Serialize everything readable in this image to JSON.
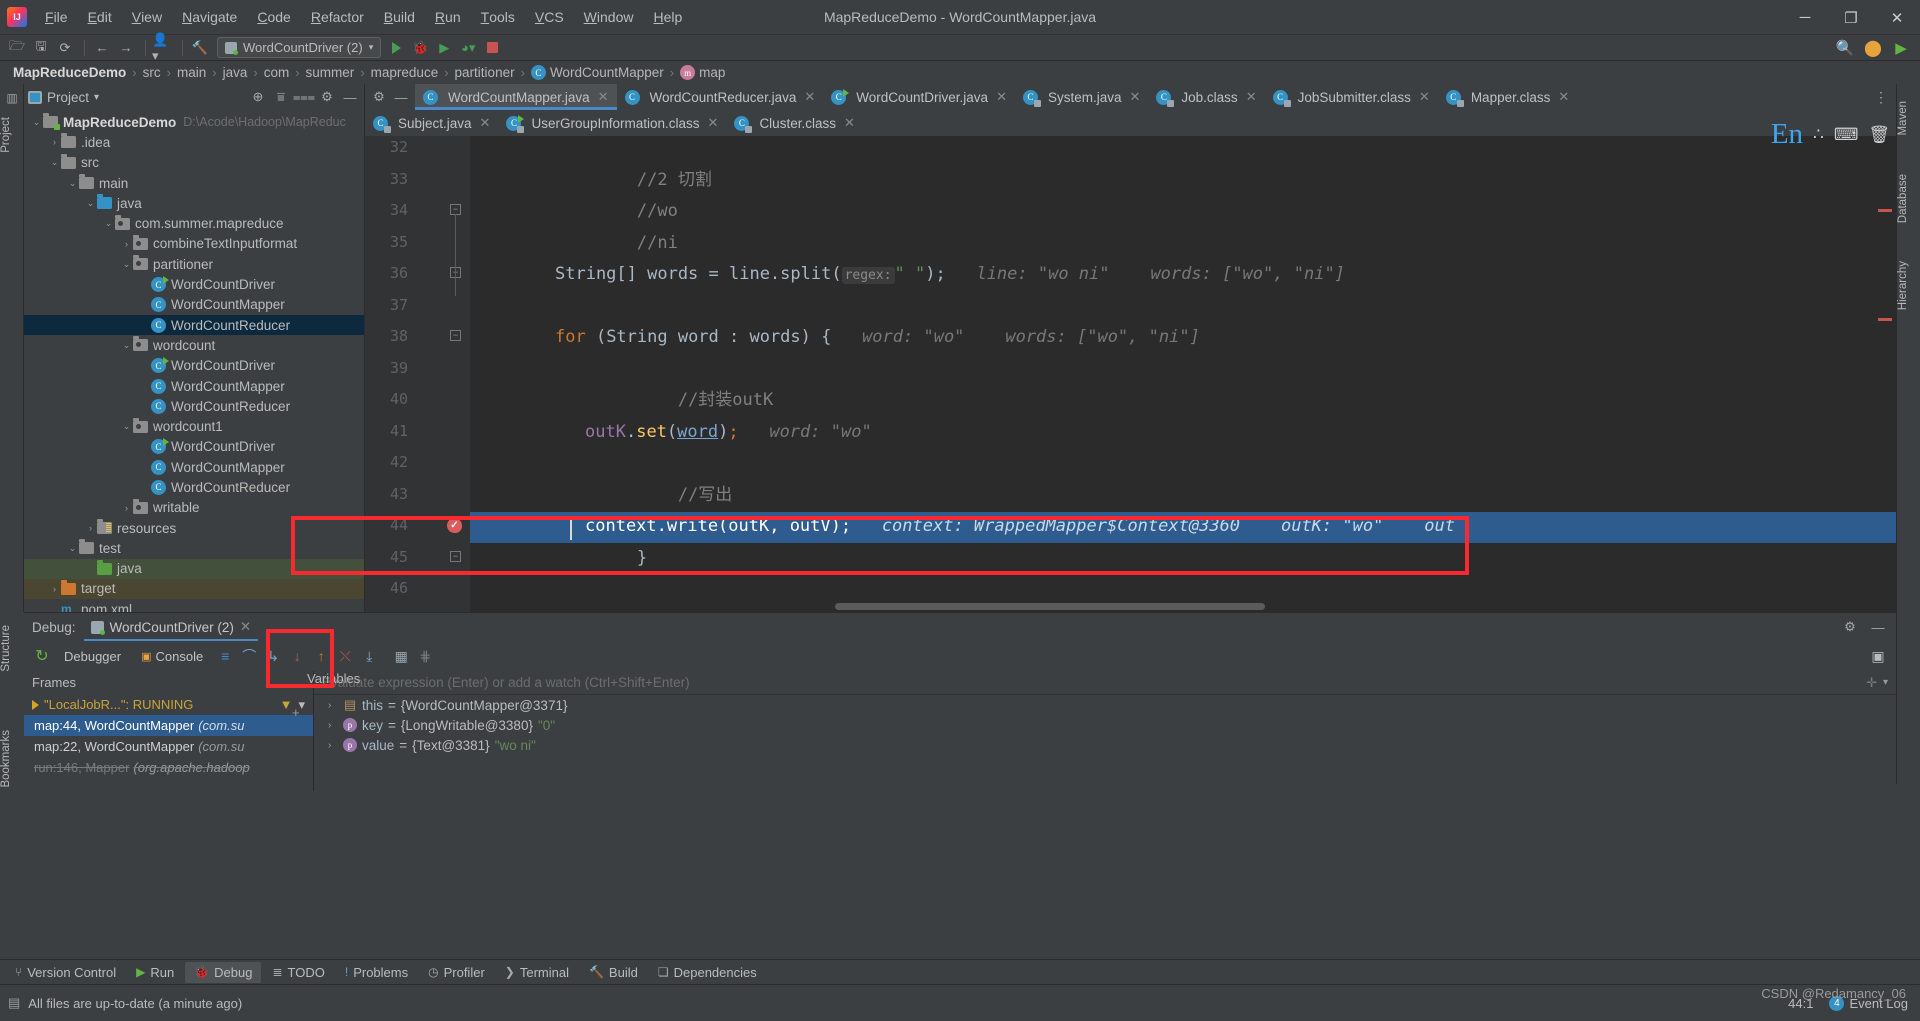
{
  "window": {
    "title": "MapReduceDemo - WordCountMapper.java",
    "minimize": "─",
    "maximize": "❐",
    "close": "✕"
  },
  "menubar": [
    "File",
    "Edit",
    "View",
    "Navigate",
    "Code",
    "Refactor",
    "Build",
    "Run",
    "Tools",
    "VCS",
    "Window",
    "Help"
  ],
  "toolbar": {
    "run_config": "WordCountDriver (2)",
    "icons": [
      "open-folder-icon",
      "save-icon",
      "sync-icon",
      "back-arrow-icon",
      "forward-arrow-icon",
      "profile-icon",
      "build-hammer-icon"
    ],
    "right_icons": [
      "search-icon",
      "update-icon",
      "run-anything-icon"
    ]
  },
  "breadcrumb": {
    "items": [
      "MapReduceDemo",
      "src",
      "main",
      "java",
      "com",
      "summer",
      "mapreduce",
      "partitioner",
      "WordCountMapper",
      "map"
    ],
    "separator": "›"
  },
  "project_panel": {
    "title": "Project",
    "chevron": "▾",
    "actions": [
      "locate-icon",
      "expand-all-icon",
      "collapse-all-icon",
      "gear-icon",
      "hide-icon"
    ],
    "tree": [
      {
        "depth": 0,
        "arrow": "⌄",
        "icon": "module-folder",
        "label": "MapReduceDemo",
        "bold": true,
        "dim": "D:\\Acode\\Hadoop\\MapReduc"
      },
      {
        "depth": 1,
        "arrow": "›",
        "icon": "folder",
        "label": ".idea"
      },
      {
        "depth": 1,
        "arrow": "⌄",
        "icon": "folder",
        "label": "src"
      },
      {
        "depth": 2,
        "arrow": "⌄",
        "icon": "folder",
        "label": "main"
      },
      {
        "depth": 3,
        "arrow": "⌄",
        "icon": "folder-blue",
        "label": "java"
      },
      {
        "depth": 4,
        "arrow": "⌄",
        "icon": "package",
        "label": "com.summer.mapreduce"
      },
      {
        "depth": 5,
        "arrow": "›",
        "icon": "package",
        "label": "combineTextInputformat"
      },
      {
        "depth": 5,
        "arrow": "⌄",
        "icon": "package",
        "label": "partitioner"
      },
      {
        "depth": 6,
        "arrow": "",
        "icon": "class-runnable",
        "label": "WordCountDriver"
      },
      {
        "depth": 6,
        "arrow": "",
        "icon": "class",
        "label": "WordCountMapper"
      },
      {
        "depth": 6,
        "arrow": "",
        "icon": "class",
        "label": "WordCountReducer",
        "selected": true
      },
      {
        "depth": 5,
        "arrow": "⌄",
        "icon": "package",
        "label": "wordcount"
      },
      {
        "depth": 6,
        "arrow": "",
        "icon": "class-runnable",
        "label": "WordCountDriver"
      },
      {
        "depth": 6,
        "arrow": "",
        "icon": "class",
        "label": "WordCountMapper"
      },
      {
        "depth": 6,
        "arrow": "",
        "icon": "class",
        "label": "WordCountReducer"
      },
      {
        "depth": 5,
        "arrow": "⌄",
        "icon": "package",
        "label": "wordcount1"
      },
      {
        "depth": 6,
        "arrow": "",
        "icon": "class-runnable",
        "label": "WordCountDriver"
      },
      {
        "depth": 6,
        "arrow": "",
        "icon": "class",
        "label": "WordCountMapper"
      },
      {
        "depth": 6,
        "arrow": "",
        "icon": "class",
        "label": "WordCountReducer"
      },
      {
        "depth": 5,
        "arrow": "›",
        "icon": "package",
        "label": "writable"
      },
      {
        "depth": 3,
        "arrow": "›",
        "icon": "folder-resources",
        "label": "resources"
      },
      {
        "depth": 2,
        "arrow": "⌄",
        "icon": "folder",
        "label": "test"
      },
      {
        "depth": 3,
        "arrow": "",
        "icon": "folder-green",
        "label": "java",
        "greenbg": true
      },
      {
        "depth": 1,
        "arrow": "›",
        "icon": "folder-orange",
        "label": "target",
        "yellowbg": true
      },
      {
        "depth": 1,
        "arrow": "",
        "icon": "xml",
        "label": "pom.xml"
      }
    ]
  },
  "editor_tabs_row1": [
    {
      "label": "WordCountMapper.java",
      "icon": "class-icon",
      "active": true,
      "close": "✕"
    },
    {
      "label": "WordCountReducer.java",
      "icon": "class-icon",
      "active": false,
      "close": "✕"
    },
    {
      "label": "WordCountDriver.java",
      "icon": "class-runnable-icon",
      "active": false,
      "close": "✕"
    },
    {
      "label": "System.java",
      "icon": "class-locked-icon",
      "active": false,
      "close": "✕"
    },
    {
      "label": "Job.class",
      "icon": "class-locked-icon",
      "active": false,
      "close": "✕"
    },
    {
      "label": "JobSubmitter.class",
      "icon": "class-locked-icon",
      "active": false,
      "close": "✕"
    },
    {
      "label": "Mapper.class",
      "icon": "class-locked-icon",
      "active": false,
      "close": "✕"
    }
  ],
  "editor_tabs_row2": [
    {
      "label": "Subject.java",
      "icon": "class-locked-icon",
      "active": false,
      "close": "✕"
    },
    {
      "label": "UserGroupInformation.class",
      "icon": "class-runnable-locked-icon",
      "active": false,
      "close": "✕"
    },
    {
      "label": "Cluster.class",
      "icon": "class-locked-icon",
      "active": false,
      "close": "✕"
    }
  ],
  "editor": {
    "lines": [
      {
        "num": "32",
        "text": ""
      },
      {
        "num": "33",
        "segments": [
          {
            "t": "        ",
            "c": "txt"
          },
          {
            "t": "//2 切割",
            "c": "cm"
          }
        ]
      },
      {
        "num": "34",
        "segments": [
          {
            "t": "        ",
            "c": "txt"
          },
          {
            "t": "//wo",
            "c": "cm"
          }
        ]
      },
      {
        "num": "35",
        "segments": [
          {
            "t": "        ",
            "c": "txt"
          },
          {
            "t": "//ni",
            "c": "cm"
          }
        ]
      },
      {
        "num": "36"
      },
      {
        "num": "37",
        "text": ""
      },
      {
        "num": "38"
      },
      {
        "num": "39",
        "text": ""
      },
      {
        "num": "40",
        "segments": [
          {
            "t": "            ",
            "c": "txt"
          },
          {
            "t": "//封装outK",
            "c": "cm"
          }
        ]
      },
      {
        "num": "41"
      },
      {
        "num": "42",
        "text": ""
      },
      {
        "num": "43",
        "segments": [
          {
            "t": "            ",
            "c": "txt"
          },
          {
            "t": "//写出",
            "c": "cm"
          }
        ]
      },
      {
        "num": "44"
      },
      {
        "num": "45",
        "segments": [
          {
            "t": "        }",
            "c": "txt"
          }
        ]
      },
      {
        "num": "46",
        "text": ""
      }
    ],
    "line36_code": "String[] words = line.split(",
    "line36_hint_label": "regex:",
    "line36_str": "\" \"",
    "line36_tail": ");",
    "line36_inline": "line: \"wo ni\"    words: [\"wo\", \"ni\"]",
    "line38_code": "for (String word : words) {",
    "line38_inline": "word: \"wo\"    words: [\"wo\", \"ni\"]",
    "line41_code": "outK.set(word);",
    "line41_inline": "word: \"wo\"",
    "line44_code": "context.write(outK, outV);",
    "line44_inline": "context: WrappedMapper$Context@3360    outK: \"wo\"    out",
    "breakpoint_line": "44",
    "caret_position": "44:1"
  },
  "lang_widget": {
    "label": "En",
    "sub": "3",
    "icons": [
      "dot-icon",
      "keyboard-icon",
      "trash-icon"
    ]
  },
  "debug": {
    "label": "Debug:",
    "session_tab": "WordCountDriver (2)",
    "session_close": "✕",
    "header_icons": [
      "settings-gear-icon",
      "hide-icon"
    ],
    "rerun_icon": "rerun-icon",
    "tabs": [
      {
        "label": "Debugger",
        "icon": "debugger-icon",
        "active": true
      },
      {
        "label": "Console",
        "icon": "console-icon",
        "active": false
      }
    ],
    "step_icons": [
      "show-execution-point-icon",
      "step-over-icon",
      "step-into-icon",
      "force-step-into-icon",
      "step-out-icon",
      "drop-frame-icon",
      "run-to-cursor-icon",
      "evaluate-expression-icon",
      "mute-breakpoints-icon"
    ],
    "frames_title": "Frames",
    "variables_title": "Variables",
    "thread": "\"LocalJobR...\": RUNNING",
    "thread_filter_icon": "filter-icon",
    "thread_chevron": "▾",
    "add_frame_icon": "+",
    "frames": [
      {
        "method": "map:44, WordCountMapper",
        "pkg": "(com.su",
        "selected": true
      },
      {
        "method": "map:22, WordCountMapper",
        "pkg": "(com.su",
        "selected": false
      },
      {
        "method": "run:146, Mapper",
        "pkg": "(org.apache.hadoop",
        "selected": false,
        "strike": true
      }
    ],
    "watch_placeholder": "Evaluate expression (Enter) or add a watch (Ctrl+Shift+Enter)",
    "variables": [
      {
        "arrow": "›",
        "kind": "obj",
        "name": "this",
        "eq": "=",
        "value": "{WordCountMapper@3371}"
      },
      {
        "arrow": "›",
        "kind": "p",
        "name": "key",
        "eq": "=",
        "value": "{LongWritable@3380}",
        "str": "\"0\""
      },
      {
        "arrow": "›",
        "kind": "p",
        "name": "value",
        "eq": "=",
        "value": "{Text@3381}",
        "str": "\"wo ni\""
      }
    ]
  },
  "tool_windows": [
    {
      "label": "Version Control",
      "icon": "version-control-icon",
      "active": false
    },
    {
      "label": "Run",
      "icon": "run-icon",
      "active": false
    },
    {
      "label": "Debug",
      "icon": "debug-icon",
      "active": true
    },
    {
      "label": "TODO",
      "icon": "todo-icon",
      "active": false
    },
    {
      "label": "Problems",
      "icon": "problems-icon",
      "active": false
    },
    {
      "label": "Profiler",
      "icon": "profiler-icon",
      "active": false
    },
    {
      "label": "Terminal",
      "icon": "terminal-icon",
      "active": false
    },
    {
      "label": "Build",
      "icon": "build-icon",
      "active": false
    },
    {
      "label": "Dependencies",
      "icon": "dependencies-icon",
      "active": false
    }
  ],
  "statusbar": {
    "message": "All files are up-to-date (a minute ago)",
    "caret": "44:1",
    "event_log": "Event Log",
    "event_count": "4",
    "watermark": "CSDN @Redamancy_06"
  },
  "side_rails": {
    "left_top": [
      "Project"
    ],
    "left_bottom": [
      "Structure",
      "Bookmarks"
    ],
    "right": [
      "Maven",
      "Database",
      "Hierarchy"
    ]
  }
}
